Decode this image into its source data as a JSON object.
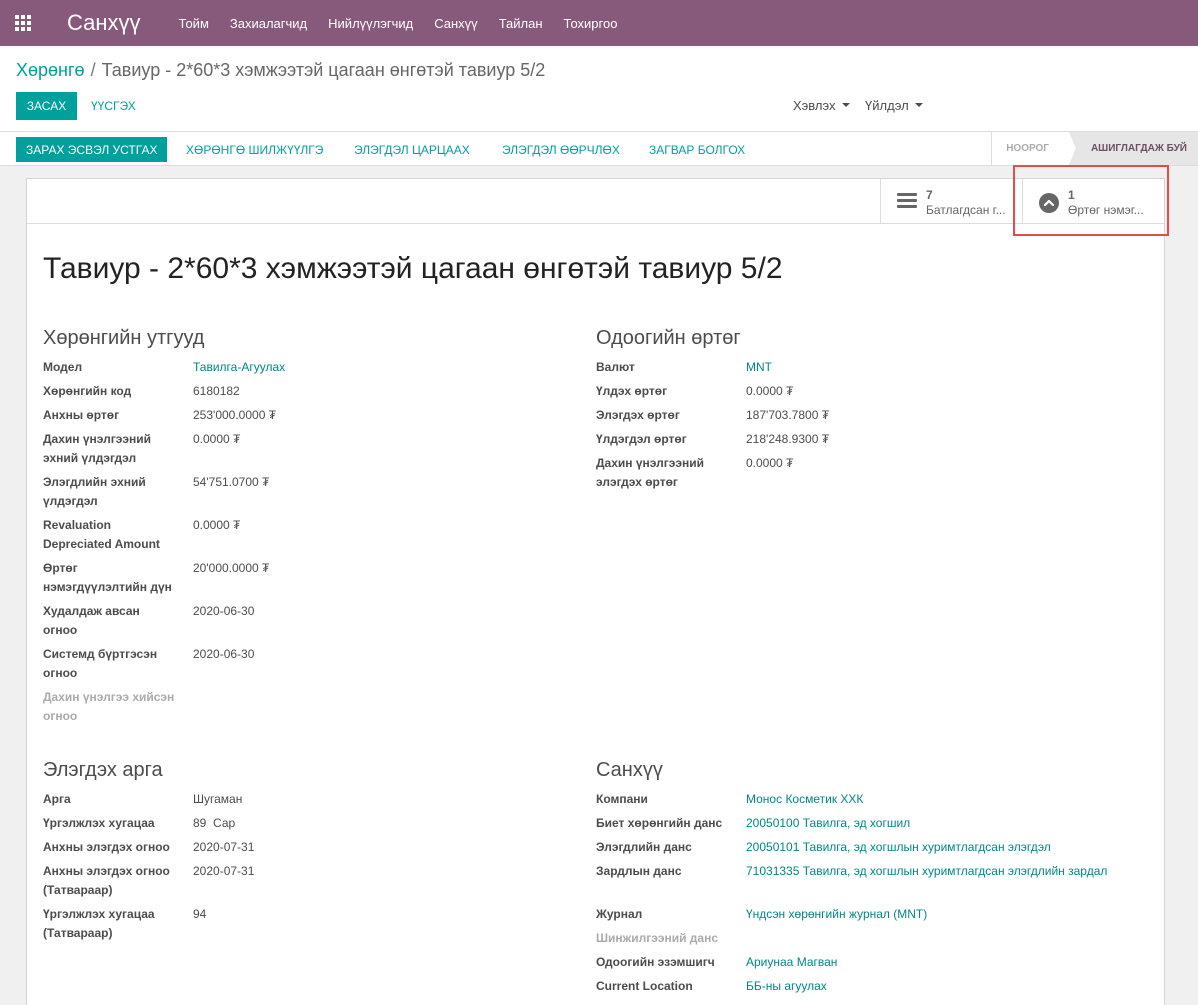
{
  "app": {
    "brand": "Санхүү",
    "menu": [
      "Тойм",
      "Захиалагчид",
      "Нийлүүлэгчид",
      "Санхүү",
      "Тайлан",
      "Тохиргоо"
    ]
  },
  "breadcrumb": {
    "parent": "Хөрөнгө",
    "separator": "/",
    "current": "Тавиур - 2*60*3 хэмжээтэй цагаан өнгөтэй тавиур 5/2"
  },
  "control": {
    "edit_label": "ЗАСАХ",
    "create_label": "ҮҮСГЭХ",
    "print_label": "Хэвлэх",
    "action_label": "Үйлдэл"
  },
  "statusbar": {
    "buttons": [
      "ЗАРАХ ЭСВЭЛ УСТГАХ",
      "ХӨРӨНГӨ ШИЛЖҮҮЛГЭ",
      "ЭЛЭГДЭЛ ЦАРЦААХ",
      "ЭЛЭГДЭЛ ӨӨРЧЛӨХ",
      "ЗАГВАР БОЛГОХ"
    ],
    "stages": [
      "НООРОГ",
      "АШИГЛАГДАЖ БУЙ"
    ],
    "active_stage": "АШИГЛАГДАЖ БУЙ"
  },
  "stat_buttons": [
    {
      "count": "7",
      "label": "Батлагдсан г...",
      "icon": "list-icon"
    },
    {
      "count": "1",
      "label": "Өртөг нэмэг...",
      "icon": "chevron-up-circle-icon"
    }
  ],
  "record": {
    "title": "Тавиур - 2*60*3 хэмжээтэй цагаан өнгөтэй тавиур 5/2"
  },
  "asset_props": {
    "title": "Хөрөнгийн утгууд",
    "fields": [
      {
        "label": "Модел",
        "value": "Тавилга-Агуулах"
      },
      {
        "label": "Хөрөнгийн код",
        "value": "6180182"
      },
      {
        "label": "Анхны өртөг",
        "value": "253'000.0000 ₮"
      },
      {
        "label": "Дахин үнэлгээний эхний үлдэгдэл",
        "value": "0.0000 ₮"
      },
      {
        "label": "Элэгдлийн эхний үлдэгдэл",
        "value": "54'751.0700 ₮"
      },
      {
        "label": "Revaluation Depreciated Amount",
        "value": "0.0000 ₮"
      },
      {
        "label": "Өртөг нэмэгдүүлэлтийн дүн",
        "value": "20'000.0000 ₮"
      },
      {
        "label": "Худалдаж авсан огноо",
        "value": "2020-06-30"
      },
      {
        "label": "Системд бүртгэсэн огноо",
        "value": "2020-06-30"
      },
      {
        "label": "Дахин үнэлгээ хийсэн огноо",
        "value": ""
      }
    ]
  },
  "current_value": {
    "title": "Одоогийн өртөг",
    "fields": [
      {
        "label": "Валют",
        "value": "MNT"
      },
      {
        "label": "Үлдэх өртөг",
        "value": "0.0000 ₮"
      },
      {
        "label": "Элэгдэх өртөг",
        "value": "187'703.7800 ₮"
      },
      {
        "label": "Үлдэгдэл өртөг",
        "value": "218'248.9300 ₮"
      },
      {
        "label": "Дахин үнэлгээний элэгдэх өртөг",
        "value": "0.0000 ₮"
      }
    ]
  },
  "depreciation": {
    "title": "Элэгдэх арга",
    "fields": [
      {
        "label": "Арга",
        "value": "Шугаман"
      },
      {
        "label": "Үргэлжлэх хугацаа",
        "value": "89  Сар"
      },
      {
        "label": "Анхны элэгдэх огноо",
        "value": "2020-07-31"
      },
      {
        "label": "Анхны элэгдэх огноо (Татвараар)",
        "value": "2020-07-31"
      },
      {
        "label": "Үргэлжлэх хугацаа (Татвараар)",
        "value": "94"
      }
    ]
  },
  "accounting": {
    "title": "Санхүү",
    "fields": [
      {
        "label": "Компани",
        "value": "Монос Косметик ХХК"
      },
      {
        "label": "Биет хөрөнгийн данс",
        "value": "20050100 Тавилга, эд хогшил"
      },
      {
        "label": "Элэгдлийн данс",
        "value": "20050101 Тавилга, эд хогшлын хуримтлагдсан элэгдэл"
      },
      {
        "label": "Зардлын данс",
        "value": "71031335 Тавилга, эд хогшлын хуримтлагдсан элэгдлийн зардал"
      },
      {
        "label": "Журнал",
        "value": "Үндсэн хөрөнгийн журнал (MNT)"
      },
      {
        "label": "Шинжилгээний данс",
        "value": ""
      },
      {
        "label": "Одоогийн эзэмшигч",
        "value": "Ариунаа Магван"
      },
      {
        "label": "Current Location",
        "value": "ББ-ны агуулах"
      }
    ]
  },
  "colors": {
    "navbar": "#875a7b",
    "primary": "#00a09d",
    "link": "#008784",
    "highlight": "#e44c4c"
  }
}
